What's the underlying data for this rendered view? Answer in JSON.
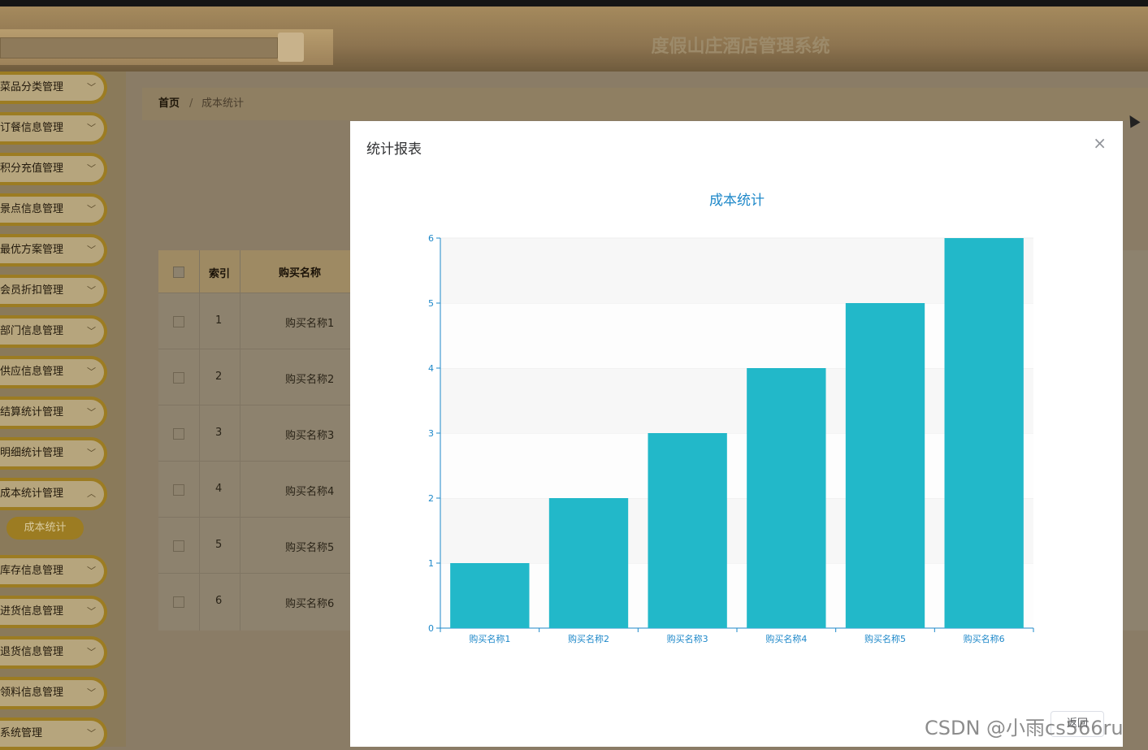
{
  "header": {
    "title": "度假山庄酒店管理系统"
  },
  "sidebar": {
    "items": [
      {
        "label": "菜品分类管理"
      },
      {
        "label": "订餐信息管理"
      },
      {
        "label": "积分充值管理"
      },
      {
        "label": "景点信息管理"
      },
      {
        "label": "最优方案管理"
      },
      {
        "label": "会员折扣管理"
      },
      {
        "label": "部门信息管理"
      },
      {
        "label": "供应信息管理"
      },
      {
        "label": "结算统计管理"
      },
      {
        "label": "明细统计管理"
      },
      {
        "label": "成本统计管理"
      }
    ],
    "active_sub": "成本统计",
    "items_after": [
      {
        "label": "库存信息管理"
      },
      {
        "label": "进货信息管理"
      },
      {
        "label": "退货信息管理"
      },
      {
        "label": "领料信息管理"
      },
      {
        "label": "系统管理"
      }
    ]
  },
  "breadcrumb": {
    "home": "首页",
    "sep": "/",
    "current": "成本统计"
  },
  "table": {
    "headers": {
      "index": "索引",
      "name": "购买名称"
    },
    "rows": [
      {
        "index": "1",
        "name": "购买名称1"
      },
      {
        "index": "2",
        "name": "购买名称2"
      },
      {
        "index": "3",
        "name": "购买名称3"
      },
      {
        "index": "4",
        "name": "购买名称4"
      },
      {
        "index": "5",
        "name": "购买名称5"
      },
      {
        "index": "6",
        "name": "购买名称6"
      }
    ]
  },
  "dialog": {
    "title": "统计报表",
    "close": "×",
    "return_label": "返回"
  },
  "chart_data": {
    "type": "bar",
    "title": "成本统计",
    "categories": [
      "购买名称1",
      "购买名称2",
      "购买名称3",
      "购买名称4",
      "购买名称5",
      "购买名称6"
    ],
    "values": [
      1,
      2,
      3,
      4,
      5,
      6
    ],
    "ylim": [
      0,
      6
    ],
    "yticks": [
      0,
      1,
      2,
      3,
      4,
      5,
      6
    ],
    "bar_color": "#22b8c9",
    "axis_color": "#1e88c9",
    "grid": true
  },
  "watermark": "CSDN @小雨cs566ru"
}
